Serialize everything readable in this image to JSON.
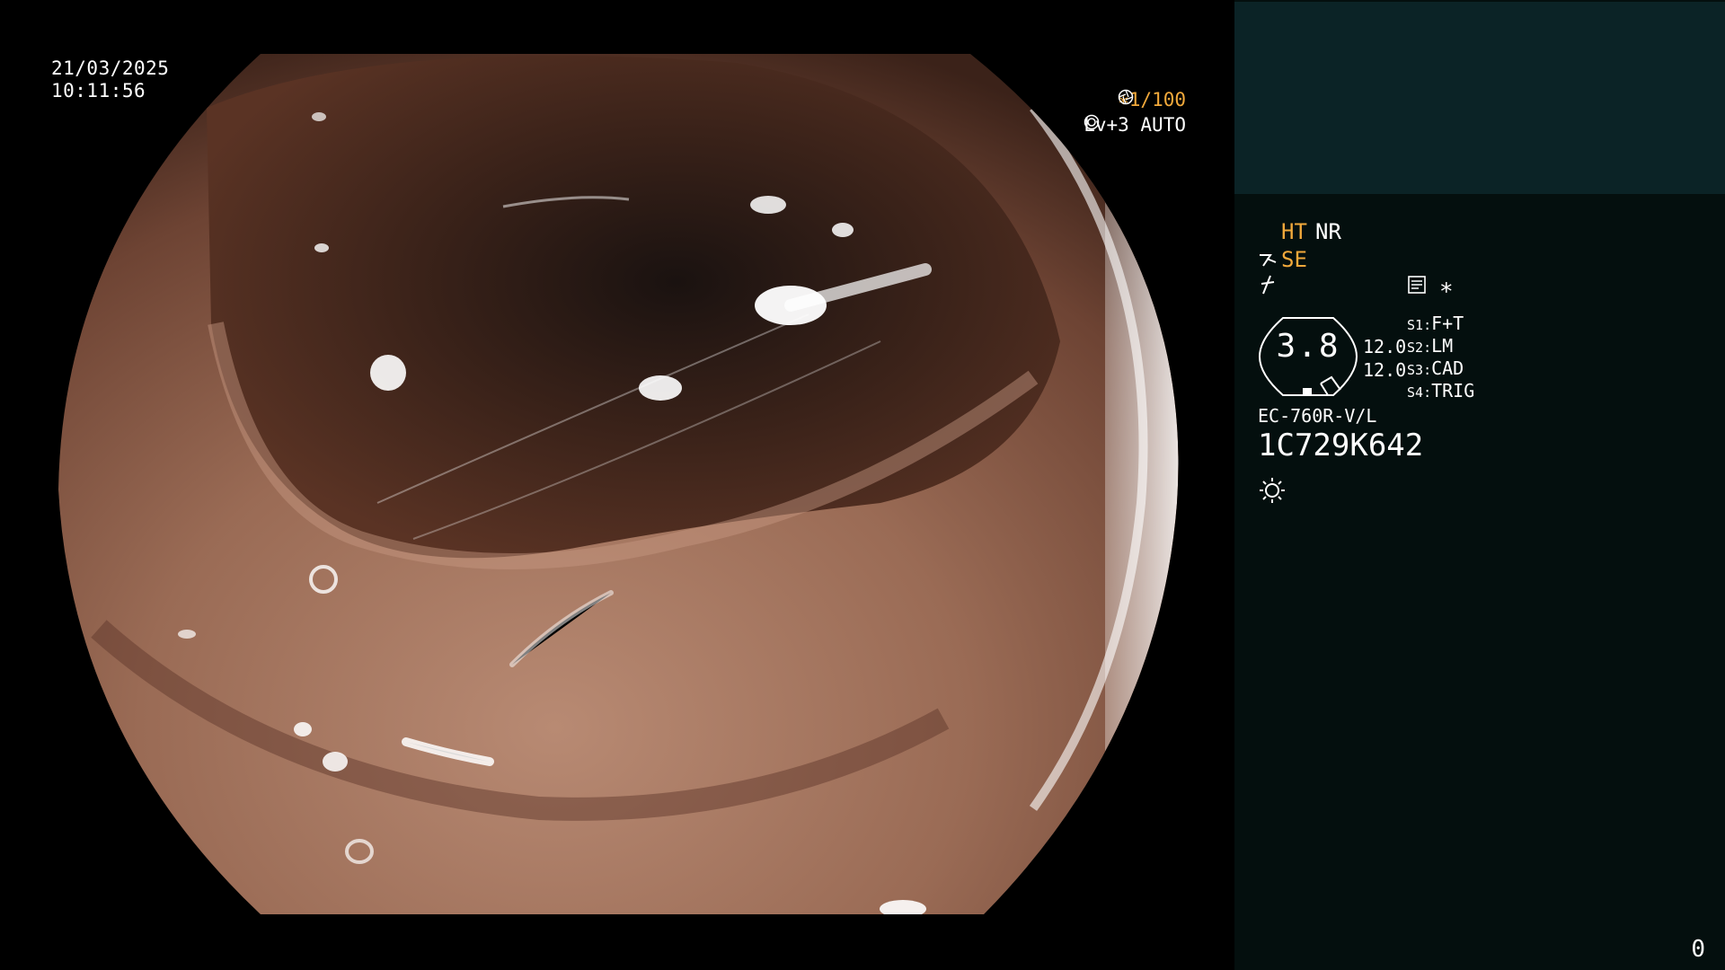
{
  "viewport": {
    "date": "21/03/2025",
    "time": "10:11:56",
    "shutter": "∗1/100",
    "shutter_icon": "aperture-icon",
    "exposure": "Lv+3 AUTO",
    "exposure_icon": "iris-icon"
  },
  "panel": {
    "ht": "HT",
    "nr": "NR",
    "se": "SE",
    "se_icon": "structure-enhance-icon",
    "enhance_icon": "edge-enhance-icon",
    "doc_icon": "memo-icon",
    "asterisk": "∗",
    "zoom": "3.8",
    "values": [
      "12.0",
      "12.0"
    ],
    "switches": [
      {
        "key": "S1",
        "value": "F+T"
      },
      {
        "key": "S2",
        "value": "LM"
      },
      {
        "key": "S3",
        "value": "CAD"
      },
      {
        "key": "S4",
        "value": "TRIG"
      }
    ],
    "scope_model": "EC-760R-V/L",
    "scope_serial": "1C729K642",
    "light_icon": "light-source-icon",
    "counter": "0"
  },
  "colors": {
    "panel_bg": "#040f0e",
    "patient_box_bg": "#0b2326",
    "accent_orange": "#f2a93b",
    "mucosa": "#8a5a45"
  }
}
